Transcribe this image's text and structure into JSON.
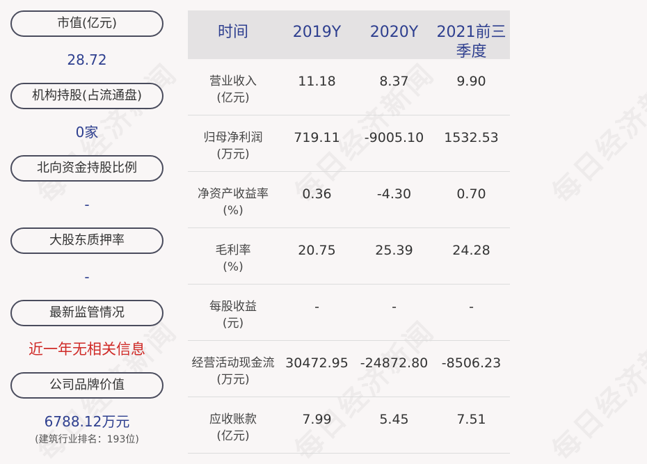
{
  "watermark": "每日经济新闻",
  "left_panel": [
    {
      "label": "市值(亿元)",
      "value": "28.72"
    },
    {
      "label": "机构持股(占流通盘)",
      "value": "0家"
    },
    {
      "label": "北向资金持股比例",
      "value": "-"
    },
    {
      "label": "大股东质押率",
      "value": "-"
    },
    {
      "label": "最新监管情况",
      "value": "近一年无相关信息"
    },
    {
      "label": "公司品牌价值",
      "value": "6788.12万元",
      "sub": "(建筑行业排名：193位)"
    }
  ],
  "table": {
    "headers": [
      "时间",
      "2019Y",
      "2020Y",
      "2021前三季度"
    ],
    "rows": [
      {
        "label1": "营业收入",
        "label2": "(亿元)",
        "values": [
          "11.18",
          "8.37",
          "9.90"
        ]
      },
      {
        "label1": "归母净利润",
        "label2": "(万元)",
        "values": [
          "719.11",
          "-9005.10",
          "1532.53"
        ]
      },
      {
        "label1": "净资产收益率",
        "label2": "(%)",
        "values": [
          "0.36",
          "-4.30",
          "0.70"
        ]
      },
      {
        "label1": "毛利率",
        "label2": "(%)",
        "values": [
          "20.75",
          "25.39",
          "24.28"
        ]
      },
      {
        "label1": "每股收益",
        "label2": "(元)",
        "values": [
          "-",
          "-",
          "-"
        ]
      },
      {
        "label1": "经营活动现金流",
        "label2": "(万元)",
        "values": [
          "30472.95",
          "-24872.80",
          "-8506.23"
        ]
      },
      {
        "label1": "应收账款",
        "label2": "(亿元)",
        "values": [
          "7.99",
          "5.45",
          "7.51"
        ]
      }
    ]
  }
}
